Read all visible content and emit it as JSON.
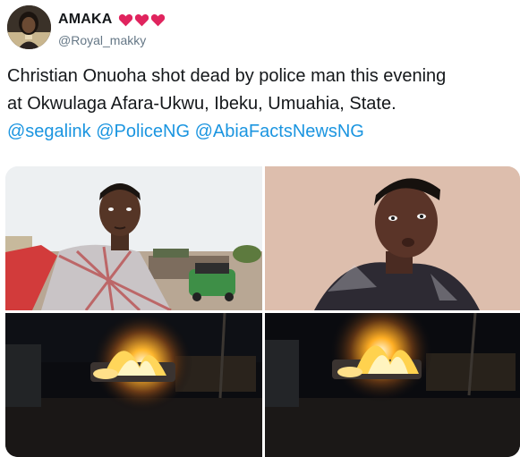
{
  "tweet": {
    "author": {
      "name": "AMAKA",
      "emoji": [
        "heart",
        "heart",
        "heart"
      ],
      "handle": "@Royal_makky"
    },
    "text": {
      "line1": "Christian Onuoha shot dead by police man this evening",
      "line2": "at Okwulaga Afara-Ukwu, Ibeku, Umuahia, State.",
      "mentions": [
        "@segalink",
        "@PoliceNG",
        "@AbiaFactsNewsNG"
      ]
    },
    "colors": {
      "mention": "#1b95e0",
      "heart": "#e0245e",
      "handle": "#657786"
    }
  }
}
